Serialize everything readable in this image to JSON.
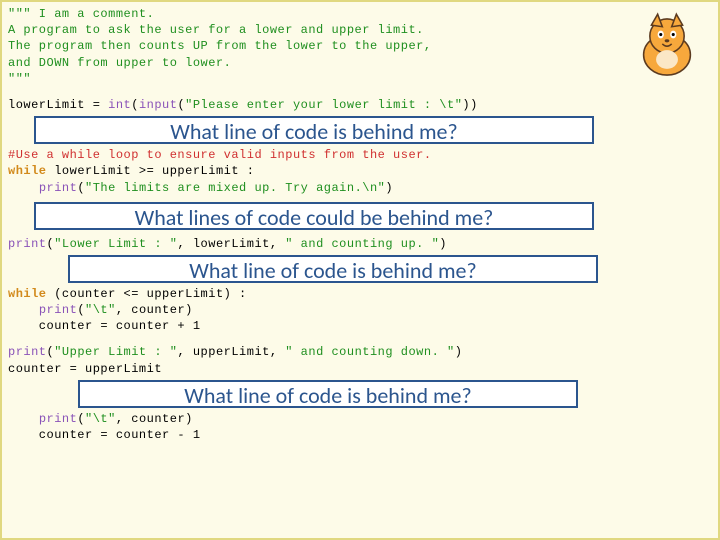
{
  "code": {
    "l01": "\"\"\" I am a comment.",
    "l02": "A program to ask the user for a lower and upper limit.",
    "l03": "The program then counts UP from the lower to the upper,",
    "l04": "and DOWN from upper to lower.",
    "l05": "\"\"\"",
    "l07a": "lowerLimit = ",
    "l07b": "int",
    "l07c": "(",
    "l07d": "input",
    "l07e": "(",
    "l07f": "\"Please enter your lower limit : \\t\"",
    "l07g": "))",
    "l09": "#Use a while loop to ensure valid inputs from the user.",
    "l10a": "while",
    "l10b": " lowerLimit >= upperLimit :",
    "l11a": "    ",
    "l11b": "print",
    "l11c": "(",
    "l11d": "\"The limits are mixed up. Try again.\\n\"",
    "l11e": ")",
    "l13a": "print",
    "l13b": "(",
    "l13c": "\"Lower Limit : \"",
    "l13d": ", lowerLimit, ",
    "l13e": "\" and counting up. \"",
    "l13f": ")",
    "l15a": "while",
    "l15b": " (counter <= upperLimit) :",
    "l16a": "    ",
    "l16b": "print",
    "l16c": "(",
    "l16d": "\"\\t\"",
    "l16e": ", counter)",
    "l17": "    counter = counter + 1",
    "l19a": "print",
    "l19b": "(",
    "l19c": "\"Upper Limit : \"",
    "l19d": ", upperLimit, ",
    "l19e": "\" and counting down. \"",
    "l19f": ")",
    "l20": "counter = upperLimit",
    "l22a": "    ",
    "l22b": "print",
    "l22c": "(",
    "l22d": "\"\\t\"",
    "l22e": ", counter)",
    "l23": "    counter = counter - 1"
  },
  "questions": {
    "q1": "What  line of code is behind me?",
    "q2": "What lines of code could be behind me?",
    "q3": "What line of code is behind me?",
    "q4": "What line of code is behind me?"
  }
}
